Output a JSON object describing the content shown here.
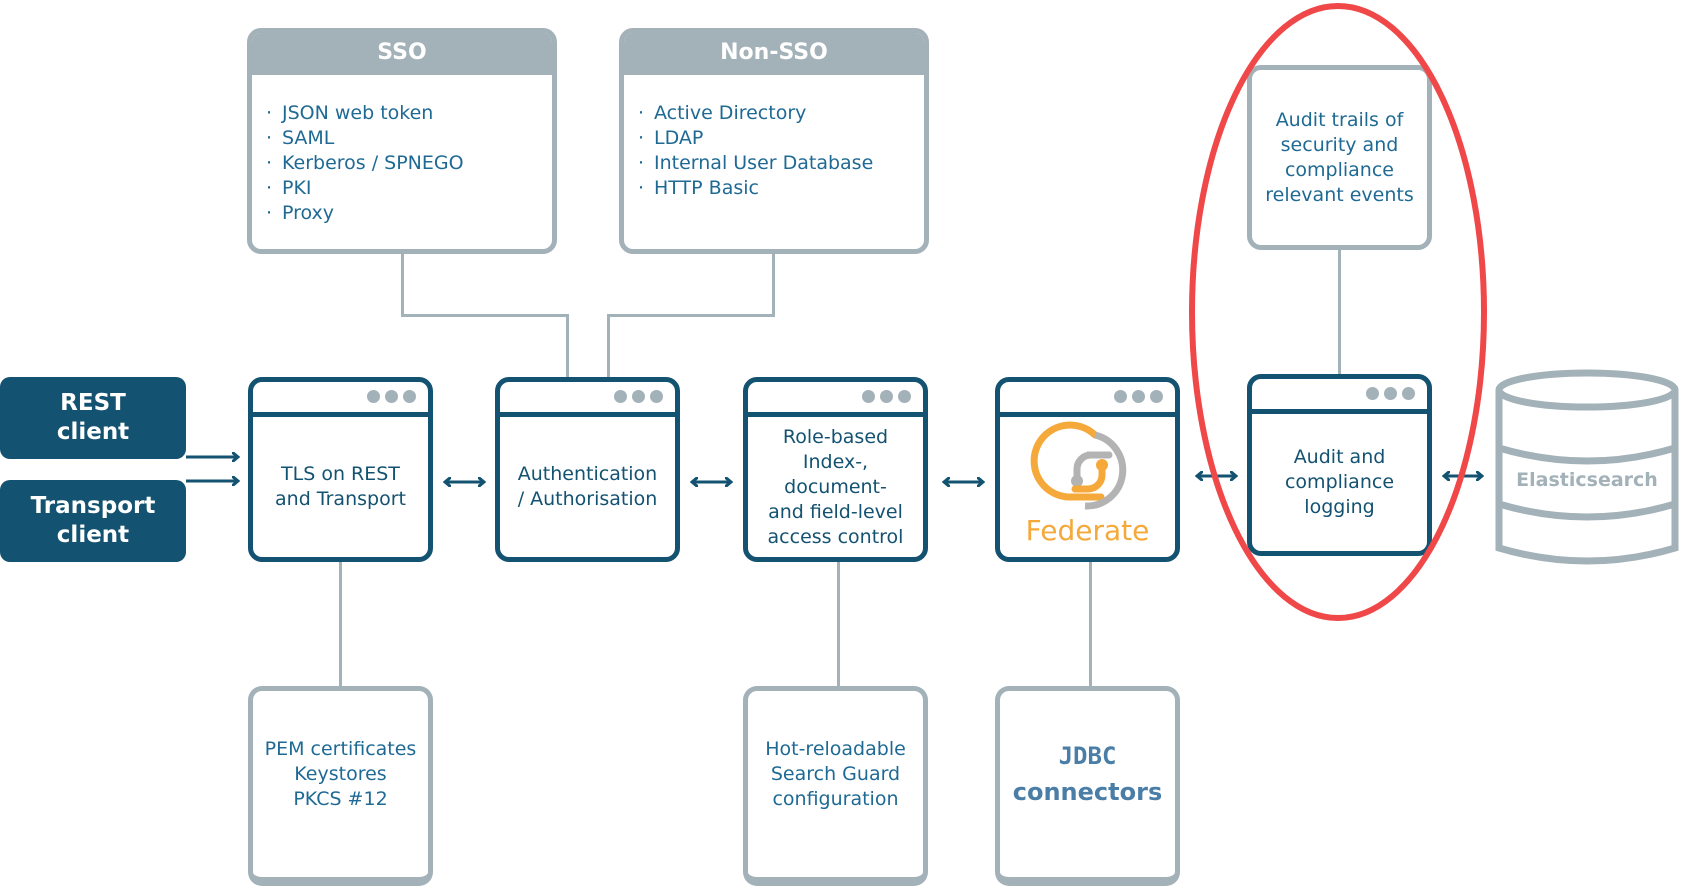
{
  "sso": {
    "title": "SSO",
    "items": [
      "JSON web token",
      "SAML",
      "Kerberos / SPNEGO",
      "PKI",
      "Proxy"
    ]
  },
  "non_sso": {
    "title": "Non-SSO",
    "items": [
      "Active Directory",
      "LDAP",
      "Internal User Database",
      "HTTP Basic"
    ]
  },
  "clients": {
    "rest": [
      "REST",
      "client"
    ],
    "transport": [
      "Transport",
      "client"
    ]
  },
  "pipeline": {
    "tls": [
      "TLS on REST",
      "and Transport"
    ],
    "auth": [
      "Authentication",
      "/ Authorisation"
    ],
    "access": [
      "Role-based",
      "Index-,",
      "document-",
      "and field-level",
      "access control"
    ],
    "federate": "Federate",
    "audit": [
      "Audit and",
      "compliance",
      "logging"
    ]
  },
  "details": {
    "audit_trails": [
      "Audit trails of",
      "security and",
      "compliance",
      "relevant events"
    ],
    "certs": [
      "PEM certificates",
      "Keystores",
      "PKCS #12"
    ],
    "config": [
      "Hot-reloadable",
      "Search Guard",
      "configuration"
    ],
    "jdbc": [
      "JDBC",
      "connectors"
    ]
  },
  "datastore": {
    "label": "Elasticsearch"
  },
  "colors": {
    "navy": "#135271",
    "grey": "#a3b1b8",
    "text_blue": "#1f6a94",
    "federate_orange": "#f5a93a",
    "highlight_red": "#f04848"
  }
}
